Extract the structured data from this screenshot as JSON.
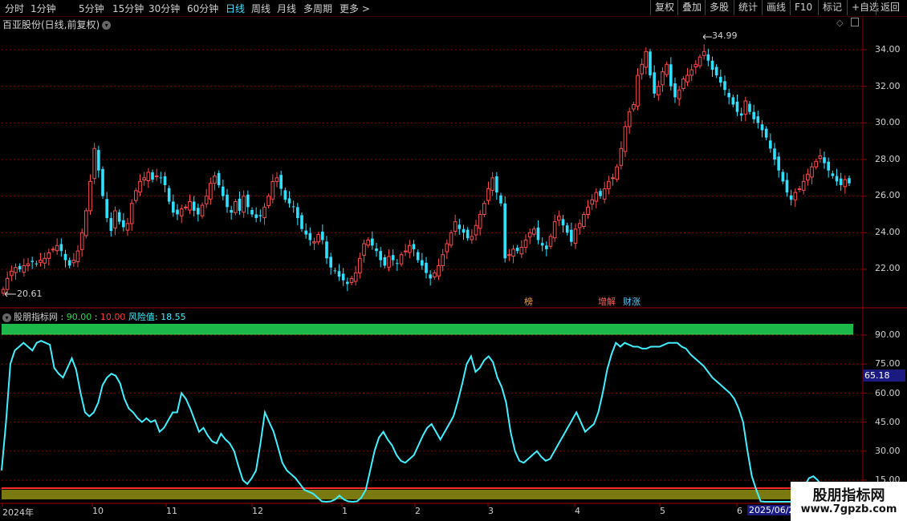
{
  "toolbar": {
    "periods": [
      "分时",
      "1分钟",
      "5分钟",
      "15分钟",
      "30分钟",
      "60分钟",
      "日线",
      "周线",
      "月线",
      "多周期",
      "更多 >"
    ],
    "active_period": "日线",
    "right_buttons": [
      "复权",
      "叠加",
      "多股",
      "统计",
      "画线",
      "F10",
      "标记",
      "+自选",
      "返回"
    ]
  },
  "main_chart": {
    "title": "百亚股份(日线,前复权)",
    "max_label": "34.99",
    "min_label": "20.61",
    "y_axis": [
      "34.00",
      "32.00",
      "30.00",
      "28.00",
      "26.00",
      "24.00",
      "22.00"
    ],
    "events": [
      {
        "text": "榜",
        "color": "#ff9a30"
      },
      {
        "text": "增解",
        "color": "#ff5a5a"
      },
      {
        "text": "财涨",
        "color": "#4ad0ff"
      }
    ]
  },
  "indicator": {
    "name": "股朋指标网",
    "high_label": "90.00",
    "low_label": "10.00",
    "risk_label": "风险值:",
    "risk_value": "18.55",
    "y_axis": [
      "90.00",
      "75.00",
      "60.00",
      "45.00",
      "30.00",
      "15.00"
    ],
    "current_marker": "65.18"
  },
  "x_axis": {
    "labels": [
      "2024年",
      "10",
      "11",
      "12",
      "1",
      "2",
      "3",
      "4",
      "5",
      "6"
    ],
    "cursor_date": "2025/06/2"
  },
  "watermark": {
    "main": "股朋指标网",
    "sub": "www.7gpzb.com"
  },
  "colors": {
    "up": "#ff4a4a",
    "down": "#30e0ff",
    "line": "#3ff0ff",
    "green_band": "#1db84a",
    "olive_band": "#7a7a10",
    "grid": "#8a0000"
  },
  "chart_data": [
    {
      "type": "candlestick",
      "title": "百亚股份(日线,前复权)",
      "ylim": [
        21.0,
        35.0
      ],
      "max": 34.99,
      "min": 20.61,
      "close": [
        20.9,
        21.5,
        21.9,
        22.1,
        22.0,
        22.2,
        22.3,
        22.4,
        22.3,
        22.5,
        22.6,
        22.9,
        23.1,
        23.3,
        23.0,
        22.5,
        22.2,
        22.5,
        23.0,
        24.0,
        25.2,
        26.8,
        28.6,
        27.4,
        26.0,
        24.8,
        24.1,
        25.2,
        24.6,
        24.3,
        24.5,
        25.6,
        26.3,
        26.8,
        27.0,
        27.3,
        26.9,
        27.1,
        27.0,
        26.6,
        25.7,
        25.1,
        25.0,
        25.3,
        25.4,
        25.7,
        25.2,
        25.0,
        25.5,
        26.0,
        26.7,
        27.1,
        26.6,
        26.0,
        25.4,
        25.1,
        25.7,
        25.2,
        26.0,
        25.4,
        25.0,
        24.8,
        24.9,
        25.4,
        26.0,
        26.8,
        27.0,
        26.4,
        25.8,
        25.6,
        25.4,
        24.8,
        24.2,
        23.9,
        23.6,
        23.5,
        23.9,
        23.6,
        22.6,
        22.1,
        21.9,
        21.6,
        21.4,
        21.2,
        21.5,
        21.8,
        22.6,
        23.4,
        23.6,
        23.3,
        23.0,
        22.5,
        22.2,
        22.7,
        22.5,
        22.3,
        22.8,
        23.0,
        23.3,
        23.1,
        22.5,
        22.2,
        21.8,
        21.5,
        21.8,
        22.2,
        22.8,
        23.4,
        24.0,
        24.6,
        24.2,
        24.0,
        23.7,
        23.8,
        24.4,
        25.0,
        25.6,
        26.4,
        27.0,
        26.2,
        25.6,
        22.6,
        22.8,
        23.1,
        23.0,
        23.2,
        23.6,
        24.0,
        24.2,
        23.6,
        23.3,
        23.1,
        23.8,
        24.6,
        24.9,
        24.4,
        24.0,
        23.5,
        24.2,
        24.5,
        25.0,
        25.4,
        25.8,
        26.2,
        26.0,
        26.4,
        26.8,
        27.0,
        27.6,
        28.6,
        29.8,
        30.6,
        31.0,
        32.6,
        33.2,
        33.9,
        32.6,
        31.6,
        32.0,
        32.8,
        33.2,
        32.0,
        31.4,
        31.8,
        32.4,
        32.6,
        32.9,
        33.2,
        33.6,
        33.9,
        33.4,
        32.9,
        32.6,
        32.2,
        31.8,
        31.4,
        31.0,
        30.6,
        30.4,
        31.2,
        30.6,
        30.2,
        30.0,
        29.6,
        29.2,
        28.6,
        28.0,
        27.4,
        26.8,
        26.2,
        25.8,
        26.2,
        26.4,
        26.8,
        27.2,
        27.6,
        27.9,
        28.2,
        27.8,
        27.4,
        27.1,
        26.8,
        26.6,
        26.9,
        26.7
      ]
    },
    {
      "type": "line",
      "title": "股朋指标网",
      "ylim": [
        10,
        90
      ],
      "hlines": [
        90,
        10
      ],
      "series": [
        {
          "name": "风险值",
          "values": [
            20,
            45,
            75,
            82,
            84,
            86,
            84,
            82,
            86,
            87,
            86,
            85,
            73,
            70,
            68,
            73,
            78,
            72,
            60,
            50,
            48,
            50,
            55,
            64,
            68,
            70,
            69,
            65,
            57,
            52,
            50,
            47,
            45,
            47,
            45,
            46,
            40,
            42,
            46,
            50,
            50,
            60,
            57,
            52,
            46,
            40,
            42,
            38,
            35,
            34,
            39,
            36,
            34,
            30,
            22,
            15,
            13,
            16,
            20,
            34,
            50,
            45,
            40,
            32,
            24,
            20,
            18,
            16,
            13,
            10,
            9,
            8,
            6,
            4,
            3,
            4,
            5,
            7,
            5,
            4,
            3,
            4,
            6,
            10,
            20,
            30,
            37,
            40,
            36,
            33,
            28,
            25,
            24,
            26,
            28,
            33,
            38,
            42,
            44,
            40,
            36,
            40,
            44,
            48,
            56,
            65,
            75,
            79,
            71,
            73,
            77,
            79,
            76,
            68,
            63,
            55,
            40,
            30,
            25,
            24,
            26,
            28,
            30,
            27,
            25,
            26,
            30,
            34,
            38,
            42,
            46,
            50,
            45,
            40,
            42,
            44,
            50,
            60,
            72,
            80,
            86,
            84,
            86,
            85,
            84,
            84,
            83,
            83,
            84,
            84,
            84,
            85,
            86,
            86,
            86,
            84,
            83,
            80,
            78,
            76,
            74,
            71,
            68,
            66,
            64,
            62,
            60,
            57,
            52,
            45,
            30,
            17,
            10,
            4,
            1,
            -2,
            -4,
            -3,
            -2,
            -1,
            0,
            3,
            8,
            12,
            16,
            17,
            15,
            12,
            12,
            13,
            10,
            9,
            8,
            8
          ]
        }
      ]
    }
  ]
}
